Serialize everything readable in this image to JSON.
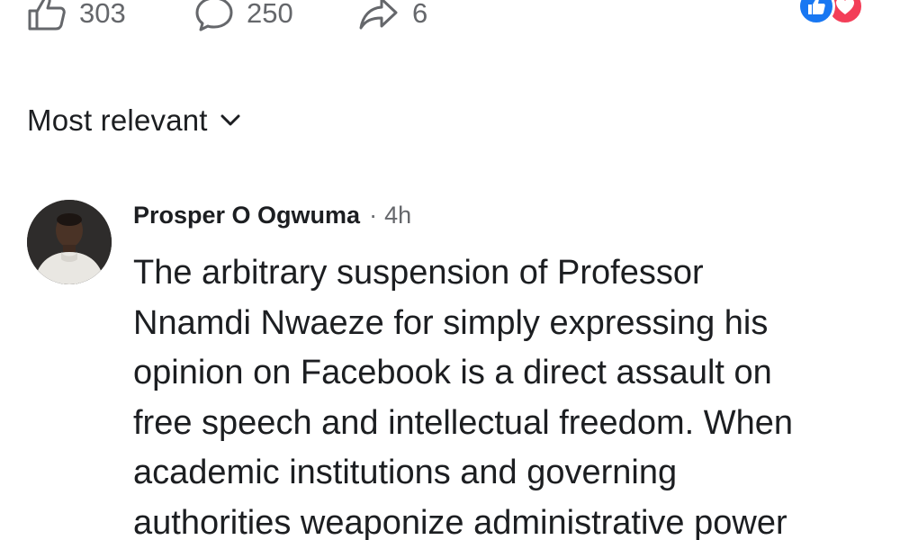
{
  "action_bar": {
    "like_count": "303",
    "comment_count": "250",
    "share_count": "6",
    "icons": [
      "thumbs-up-icon",
      "comment-icon",
      "share-icon"
    ]
  },
  "reactions": {
    "types": [
      "like",
      "love"
    ],
    "colors": {
      "like": "#1877f2",
      "love": "#f33e58"
    }
  },
  "sort": {
    "label": "Most relevant"
  },
  "comment": {
    "author": "Prosper O Ogwuma",
    "separator": "·",
    "time": "4h",
    "text_lines": [
      "The arbitrary suspension of Professor",
      "Nnamdi Nwaeze for simply expressing his",
      "opinion on Facebook is a direct assault on",
      "free speech and intellectual freedom. When",
      "academic institutions and governing",
      "authorities weaponize administrative power"
    ]
  },
  "colors": {
    "text_primary": "#1c1e21",
    "text_secondary": "#65676b",
    "background": "#ffffff"
  }
}
